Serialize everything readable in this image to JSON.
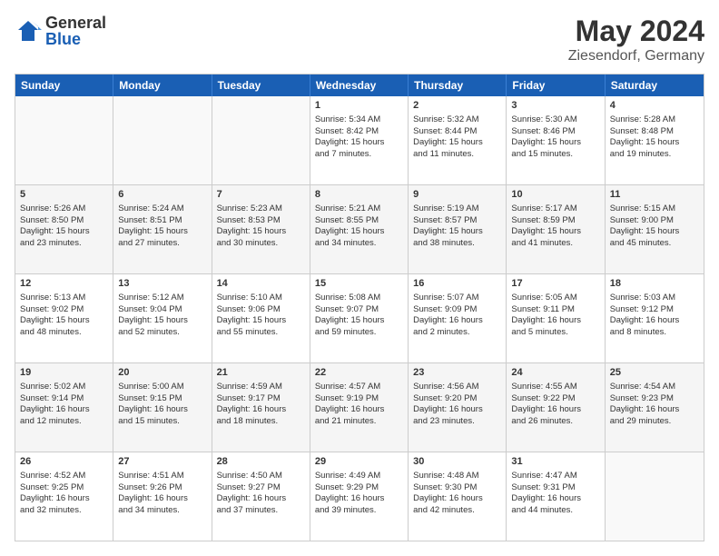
{
  "header": {
    "logo_general": "General",
    "logo_blue": "Blue",
    "title": "May 2024",
    "subtitle": "Ziesendorf, Germany"
  },
  "weekdays": [
    "Sunday",
    "Monday",
    "Tuesday",
    "Wednesday",
    "Thursday",
    "Friday",
    "Saturday"
  ],
  "rows": [
    [
      {
        "day": "",
        "info": "",
        "empty": true
      },
      {
        "day": "",
        "info": "",
        "empty": true
      },
      {
        "day": "",
        "info": "",
        "empty": true
      },
      {
        "day": "1",
        "info": "Sunrise: 5:34 AM\nSunset: 8:42 PM\nDaylight: 15 hours\nand 7 minutes.",
        "empty": false
      },
      {
        "day": "2",
        "info": "Sunrise: 5:32 AM\nSunset: 8:44 PM\nDaylight: 15 hours\nand 11 minutes.",
        "empty": false
      },
      {
        "day": "3",
        "info": "Sunrise: 5:30 AM\nSunset: 8:46 PM\nDaylight: 15 hours\nand 15 minutes.",
        "empty": false
      },
      {
        "day": "4",
        "info": "Sunrise: 5:28 AM\nSunset: 8:48 PM\nDaylight: 15 hours\nand 19 minutes.",
        "empty": false
      }
    ],
    [
      {
        "day": "5",
        "info": "Sunrise: 5:26 AM\nSunset: 8:50 PM\nDaylight: 15 hours\nand 23 minutes.",
        "empty": false
      },
      {
        "day": "6",
        "info": "Sunrise: 5:24 AM\nSunset: 8:51 PM\nDaylight: 15 hours\nand 27 minutes.",
        "empty": false
      },
      {
        "day": "7",
        "info": "Sunrise: 5:23 AM\nSunset: 8:53 PM\nDaylight: 15 hours\nand 30 minutes.",
        "empty": false
      },
      {
        "day": "8",
        "info": "Sunrise: 5:21 AM\nSunset: 8:55 PM\nDaylight: 15 hours\nand 34 minutes.",
        "empty": false
      },
      {
        "day": "9",
        "info": "Sunrise: 5:19 AM\nSunset: 8:57 PM\nDaylight: 15 hours\nand 38 minutes.",
        "empty": false
      },
      {
        "day": "10",
        "info": "Sunrise: 5:17 AM\nSunset: 8:59 PM\nDaylight: 15 hours\nand 41 minutes.",
        "empty": false
      },
      {
        "day": "11",
        "info": "Sunrise: 5:15 AM\nSunset: 9:00 PM\nDaylight: 15 hours\nand 45 minutes.",
        "empty": false
      }
    ],
    [
      {
        "day": "12",
        "info": "Sunrise: 5:13 AM\nSunset: 9:02 PM\nDaylight: 15 hours\nand 48 minutes.",
        "empty": false
      },
      {
        "day": "13",
        "info": "Sunrise: 5:12 AM\nSunset: 9:04 PM\nDaylight: 15 hours\nand 52 minutes.",
        "empty": false
      },
      {
        "day": "14",
        "info": "Sunrise: 5:10 AM\nSunset: 9:06 PM\nDaylight: 15 hours\nand 55 minutes.",
        "empty": false
      },
      {
        "day": "15",
        "info": "Sunrise: 5:08 AM\nSunset: 9:07 PM\nDaylight: 15 hours\nand 59 minutes.",
        "empty": false
      },
      {
        "day": "16",
        "info": "Sunrise: 5:07 AM\nSunset: 9:09 PM\nDaylight: 16 hours\nand 2 minutes.",
        "empty": false
      },
      {
        "day": "17",
        "info": "Sunrise: 5:05 AM\nSunset: 9:11 PM\nDaylight: 16 hours\nand 5 minutes.",
        "empty": false
      },
      {
        "day": "18",
        "info": "Sunrise: 5:03 AM\nSunset: 9:12 PM\nDaylight: 16 hours\nand 8 minutes.",
        "empty": false
      }
    ],
    [
      {
        "day": "19",
        "info": "Sunrise: 5:02 AM\nSunset: 9:14 PM\nDaylight: 16 hours\nand 12 minutes.",
        "empty": false
      },
      {
        "day": "20",
        "info": "Sunrise: 5:00 AM\nSunset: 9:15 PM\nDaylight: 16 hours\nand 15 minutes.",
        "empty": false
      },
      {
        "day": "21",
        "info": "Sunrise: 4:59 AM\nSunset: 9:17 PM\nDaylight: 16 hours\nand 18 minutes.",
        "empty": false
      },
      {
        "day": "22",
        "info": "Sunrise: 4:57 AM\nSunset: 9:19 PM\nDaylight: 16 hours\nand 21 minutes.",
        "empty": false
      },
      {
        "day": "23",
        "info": "Sunrise: 4:56 AM\nSunset: 9:20 PM\nDaylight: 16 hours\nand 23 minutes.",
        "empty": false
      },
      {
        "day": "24",
        "info": "Sunrise: 4:55 AM\nSunset: 9:22 PM\nDaylight: 16 hours\nand 26 minutes.",
        "empty": false
      },
      {
        "day": "25",
        "info": "Sunrise: 4:54 AM\nSunset: 9:23 PM\nDaylight: 16 hours\nand 29 minutes.",
        "empty": false
      }
    ],
    [
      {
        "day": "26",
        "info": "Sunrise: 4:52 AM\nSunset: 9:25 PM\nDaylight: 16 hours\nand 32 minutes.",
        "empty": false
      },
      {
        "day": "27",
        "info": "Sunrise: 4:51 AM\nSunset: 9:26 PM\nDaylight: 16 hours\nand 34 minutes.",
        "empty": false
      },
      {
        "day": "28",
        "info": "Sunrise: 4:50 AM\nSunset: 9:27 PM\nDaylight: 16 hours\nand 37 minutes.",
        "empty": false
      },
      {
        "day": "29",
        "info": "Sunrise: 4:49 AM\nSunset: 9:29 PM\nDaylight: 16 hours\nand 39 minutes.",
        "empty": false
      },
      {
        "day": "30",
        "info": "Sunrise: 4:48 AM\nSunset: 9:30 PM\nDaylight: 16 hours\nand 42 minutes.",
        "empty": false
      },
      {
        "day": "31",
        "info": "Sunrise: 4:47 AM\nSunset: 9:31 PM\nDaylight: 16 hours\nand 44 minutes.",
        "empty": false
      },
      {
        "day": "",
        "info": "",
        "empty": true
      }
    ]
  ]
}
